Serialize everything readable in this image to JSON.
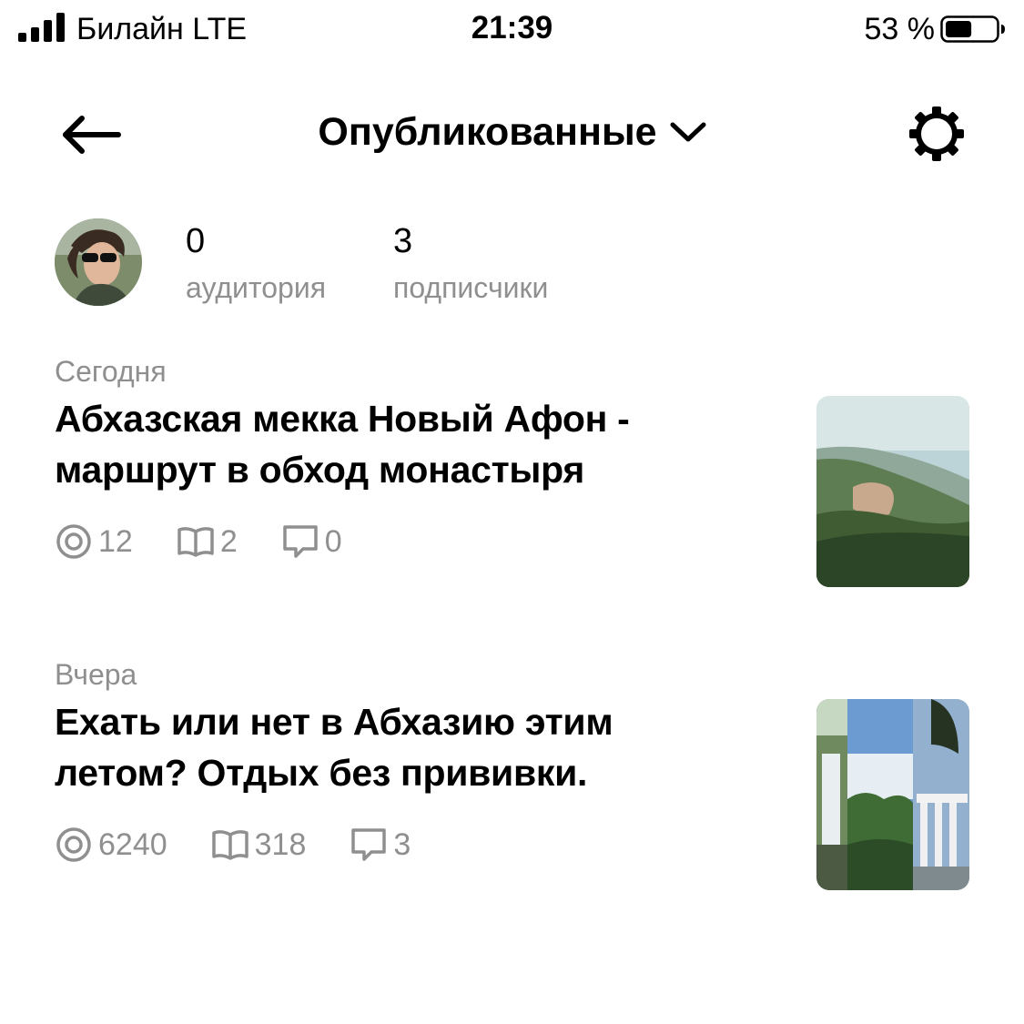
{
  "status_bar": {
    "carrier": "Билайн  LTE",
    "time": "21:39",
    "battery_percent": "53 %",
    "battery_level": 0.53
  },
  "header": {
    "back_icon": "arrow-left-icon",
    "title": "Опубликованные",
    "dropdown_icon": "chevron-down-icon",
    "settings_icon": "gear-icon"
  },
  "profile": {
    "audience_value": "0",
    "audience_label": "аудитория",
    "subscribers_value": "3",
    "subscribers_label": "подписчики"
  },
  "articles": [
    {
      "date": "Сегодня",
      "title": "Абхазская мекка Новый Афон - маршрут в обход монастыря",
      "views": "12",
      "reads": "2",
      "comments": "0"
    },
    {
      "date": "Вчера",
      "title": "Ехать или нет в Абхазию этим летом? Отдых без прививки.",
      "views": "6240",
      "reads": "318",
      "comments": "3"
    }
  ],
  "icons": {
    "views": "eye-target-icon",
    "reads": "book-icon",
    "comments": "comment-icon"
  },
  "colors": {
    "text": "#000000",
    "secondary_text": "#8f8f8f",
    "background": "#ffffff"
  }
}
